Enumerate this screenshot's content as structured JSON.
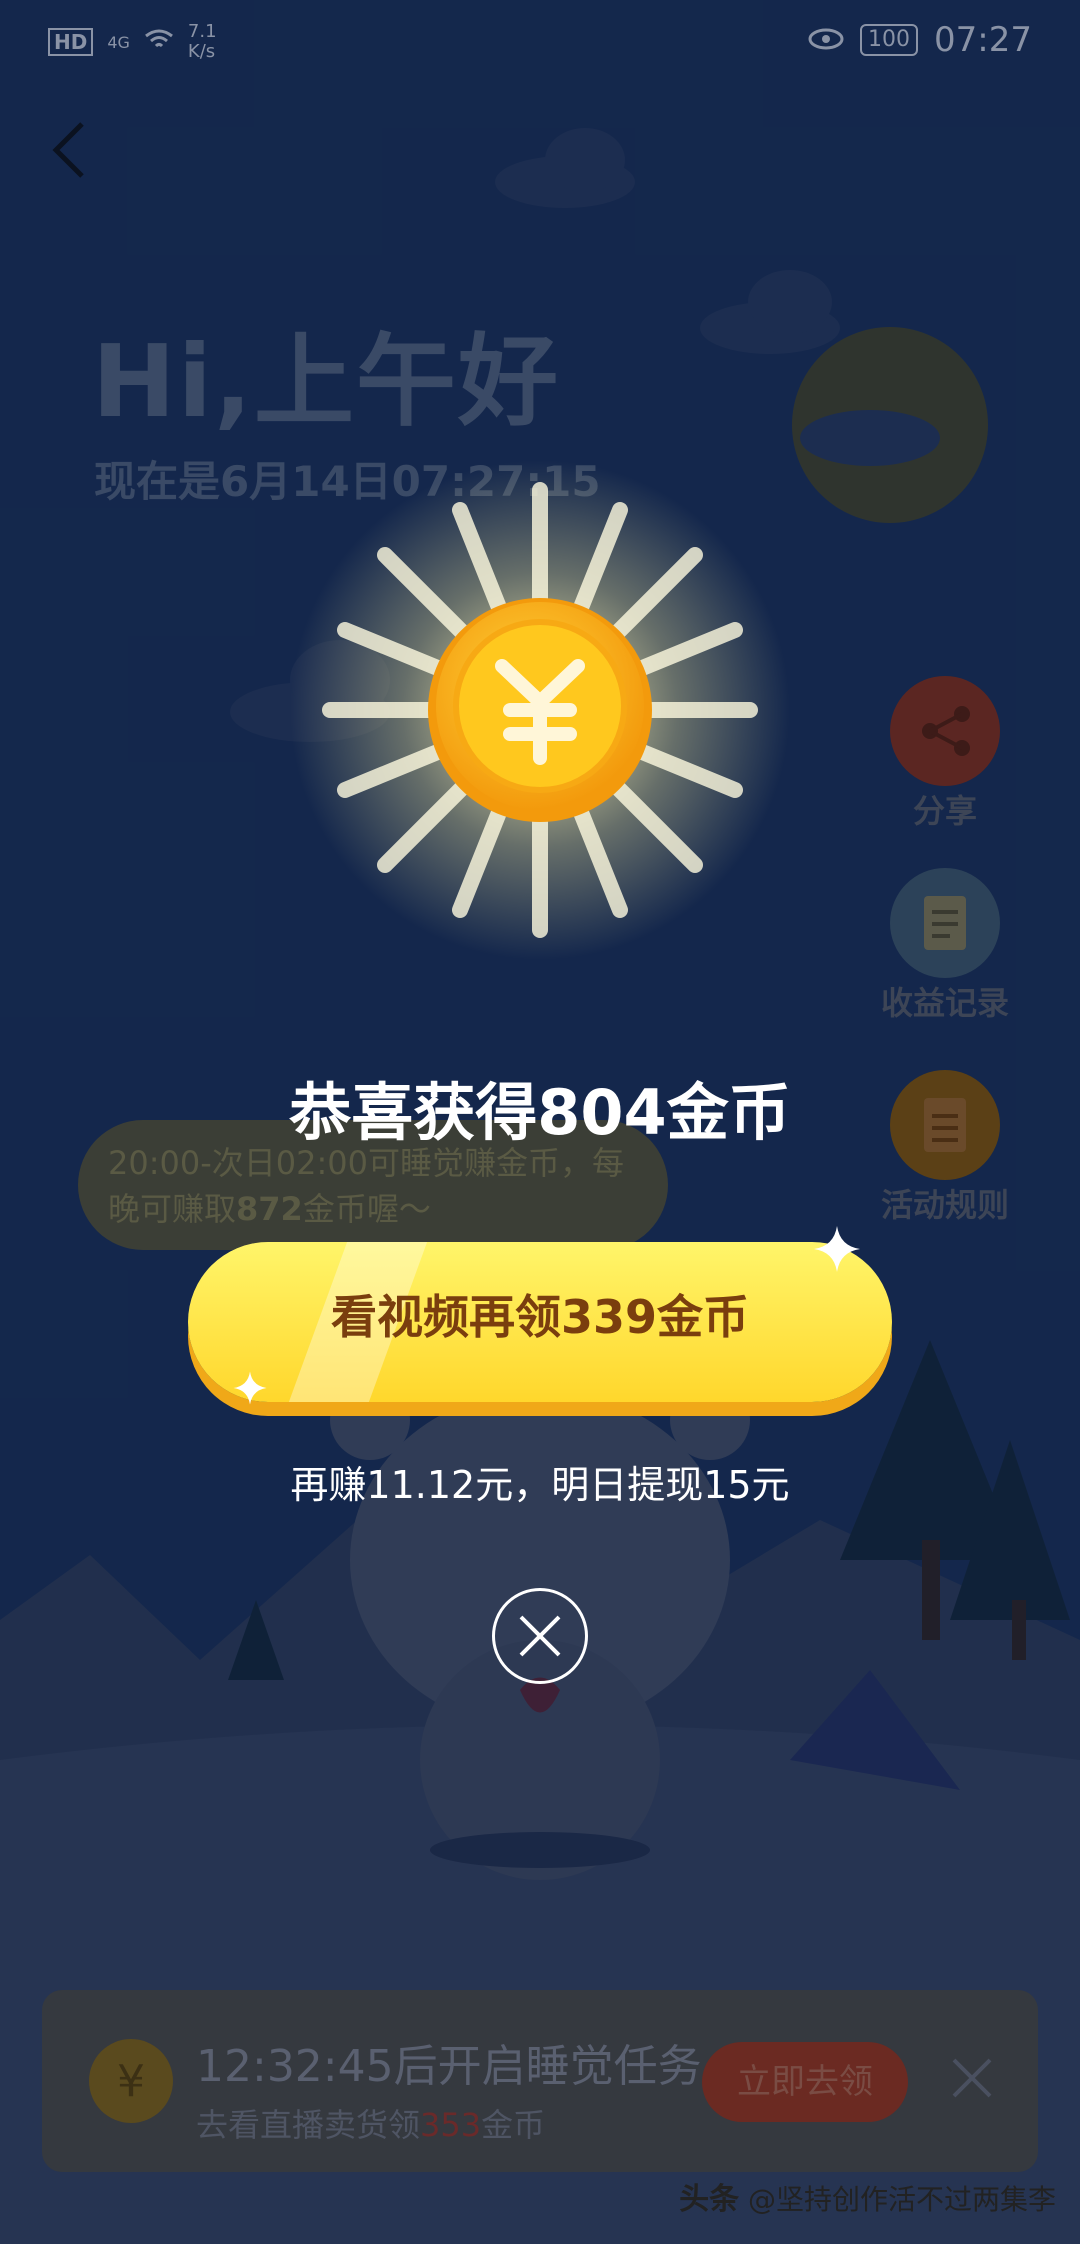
{
  "status_bar": {
    "left_icons": [
      "HD",
      "4G",
      "wifi-icon"
    ],
    "speed_value": "7.1",
    "speed_unit": "K/s",
    "battery": "100",
    "time": "07:27"
  },
  "header": {
    "greeting": "Hi,上午好",
    "now_text": "现在是6月14日07:27:15"
  },
  "side_buttons": [
    {
      "label": "分享",
      "icon": "share-icon"
    },
    {
      "label": "收益记录",
      "icon": "record-icon"
    },
    {
      "label": "活动规则",
      "icon": "rules-icon"
    }
  ],
  "sleep_tip": {
    "line1": "20:00-次日02:00可睡觉赚金币，每",
    "line2_prefix": "晚可赚取",
    "line2_amount": "872",
    "line2_suffix": "金币喔～"
  },
  "popup": {
    "coin_icon": "yuan-coin-icon",
    "title": "恭喜获得804金币",
    "video_button": "看视频再领339金币",
    "earn_text": "再赚11.12元，明日提现15元",
    "close_icon": "close-circle-icon"
  },
  "bottom_card": {
    "timer_text": "12:32:45后开启睡觉任务",
    "sub_prefix": "去看直播卖货领",
    "sub_amount": "353",
    "sub_suffix": "金币",
    "go_button": "立即去领"
  },
  "watermark": {
    "brand": "头条",
    "handle": "@坚持创作活不过两集李"
  },
  "colors": {
    "background": "#1d3a68",
    "button_yellow": "#ffd72c",
    "button_text": "#7a3e0e",
    "coin_gold": "#f9b815"
  }
}
